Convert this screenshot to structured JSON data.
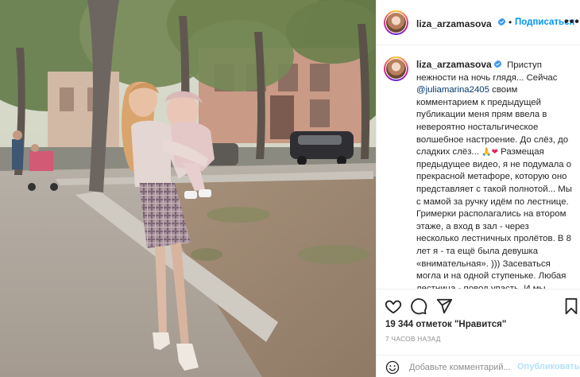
{
  "post": {
    "photo": {
      "alt": "Vintage photo: woman holding a baby on a city sidewalk",
      "icon": "photo"
    },
    "author": {
      "username": "liza_arzamasova",
      "verified": true,
      "avatar_icon": "avatar"
    },
    "header": {
      "separator": "•",
      "follow_label": "Подписаться",
      "more_label": "•••"
    },
    "caption": {
      "text_before_mention": "Приступ нежности на ночь глядя... Сейчас ",
      "mention": "@juliamarina2405",
      "text_part1": " своим комментарием к предыдущей публикации меня прям ввела в невероятно ностальгическое волшебное настроение. До слёз, до сладких слёз... ",
      "emoji1": "🙏",
      "emoji2": "❤",
      "text_part2": " Размещая предыдущее видео, я не подумала о прекрасной метафоре, которую оно представляет с такой полнотой... Мы с мамой за ручку идём по лестнице. Гримерки располагались на втором этаже, а вход в зал - через несколько лестничных пролётов. В 8 лет я - та ещё была девушка «внимательная». ))) Засеваться могла и на одной ступеньке. Любая лестница - повод упасть. И мы ходили за руку. Ответственно, чтобы"
    },
    "actions": {
      "like_icon": "heart",
      "comment_icon": "comment",
      "share_icon": "share",
      "save_icon": "bookmark"
    },
    "likes_text": "19 344 отметок \"Нравится\"",
    "timestamp": "7 ЧАСОВ НАЗАД",
    "comment_box": {
      "emoji_icon": "smiley",
      "placeholder": "Добавьте комментарий...",
      "publish_label": "Опубликовать"
    }
  },
  "colors": {
    "accent": "#0095f6",
    "publish_disabled": "#b2dffc",
    "mention": "#00376b",
    "text": "#262626",
    "muted": "#8e8e8e",
    "border": "#efefef"
  }
}
